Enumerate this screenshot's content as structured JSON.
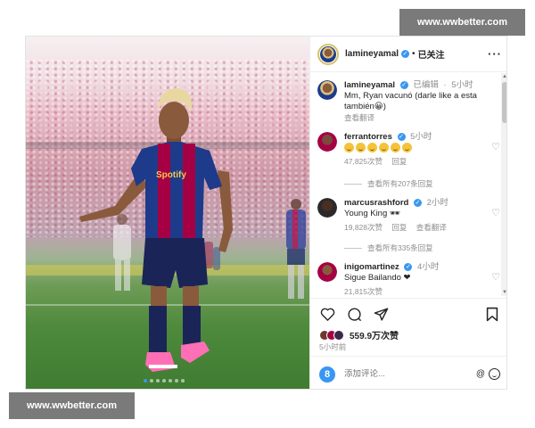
{
  "header": {
    "username": "lamineyamal",
    "verified_mark": "✓",
    "separator": "•",
    "follow_status": "已关注",
    "more_icon": "more-horizontal-icon"
  },
  "caption": {
    "username": "lamineyamal",
    "edited": "已编辑",
    "time": "5小时",
    "text": "Mm, Ryan vacunó (darle like a esta también😀)",
    "translate": "查看翻译"
  },
  "comments": [
    {
      "username": "ferrantorres",
      "time": "5小时",
      "text": "",
      "emoji_count": 6,
      "likes": "47,825次赞",
      "reply": "回复",
      "view_replies": "查看所有207条回复"
    },
    {
      "username": "marcusrashford",
      "time": "2小时",
      "text": "Young King 🕶",
      "likes": "19,828次赞",
      "reply": "回复",
      "translate": "查看翻译",
      "view_replies": "查看所有335条回复"
    },
    {
      "username": "inigomartinez",
      "time": "4小时",
      "text": "Sigue Bailando ❤",
      "likes": "21,815次赞"
    }
  ],
  "actions": {
    "likes_count": "559.9万次赞",
    "post_time": "5小时前",
    "comment_placeholder": "添加评论...",
    "at_symbol": "@",
    "logo_letter": "8"
  },
  "carousel": {
    "count": 7,
    "active_index": 0
  },
  "watermarks": {
    "top": "www.wwbetter.com",
    "bottom": "www.wwbetter.com"
  },
  "colors": {
    "verified": "#3897f0",
    "heart": "#e0245e",
    "jersey_blue": "#1e3a8a",
    "jersey_red": "#a50044"
  }
}
